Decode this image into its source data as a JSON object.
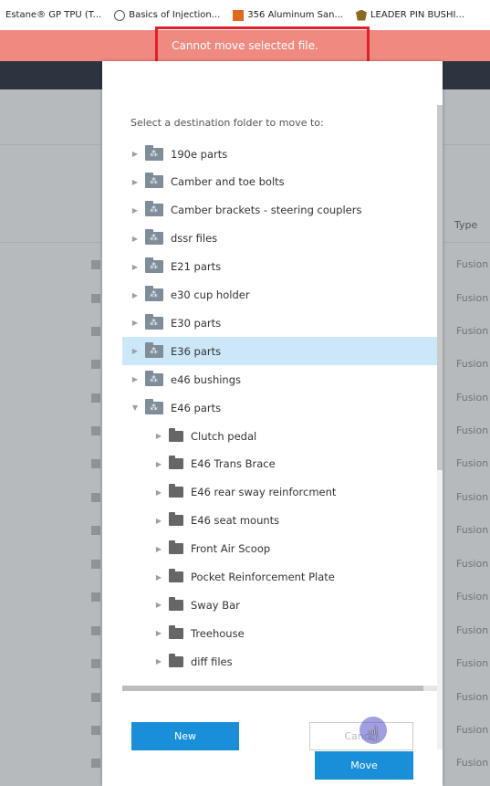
{
  "bookmarks": [
    {
      "label": "Estane® GP TPU (T...",
      "icon": "none"
    },
    {
      "label": "Basics of Injection...",
      "icon": "globe-icon"
    },
    {
      "label": "356 Aluminum San...",
      "icon": "orange-logo-icon"
    },
    {
      "label": "LEADER PIN BUSHI...",
      "icon": "shield-icon"
    }
  ],
  "banner": {
    "message": "Cannot move selected file."
  },
  "background": {
    "type_header": "Type",
    "type_cell": "Fusion"
  },
  "modal": {
    "instruction": "Select a destination folder to move to:",
    "folders": [
      {
        "label": "190e parts"
      },
      {
        "label": "Camber and toe bolts"
      },
      {
        "label": "Camber brackets - steering couplers"
      },
      {
        "label": "dssr files"
      },
      {
        "label": "E21 parts"
      },
      {
        "label": "e30 cup holder"
      },
      {
        "label": "E30 parts"
      },
      {
        "label": "E36 parts",
        "selected": true
      },
      {
        "label": "e46 bushings"
      },
      {
        "label": "E46 parts",
        "expanded": true
      }
    ],
    "subfolders": [
      {
        "label": "Clutch pedal"
      },
      {
        "label": "E46 Trans Brace"
      },
      {
        "label": "E46 rear sway reinforcment"
      },
      {
        "label": "E46 seat mounts"
      },
      {
        "label": "Front Air Scoop"
      },
      {
        "label": "Pocket Reinforcement Plate"
      },
      {
        "label": "Sway Bar"
      },
      {
        "label": "Treehouse"
      },
      {
        "label": "diff files"
      }
    ],
    "buttons": {
      "new": "New",
      "cancel": "Cancel",
      "move": "Move"
    }
  }
}
